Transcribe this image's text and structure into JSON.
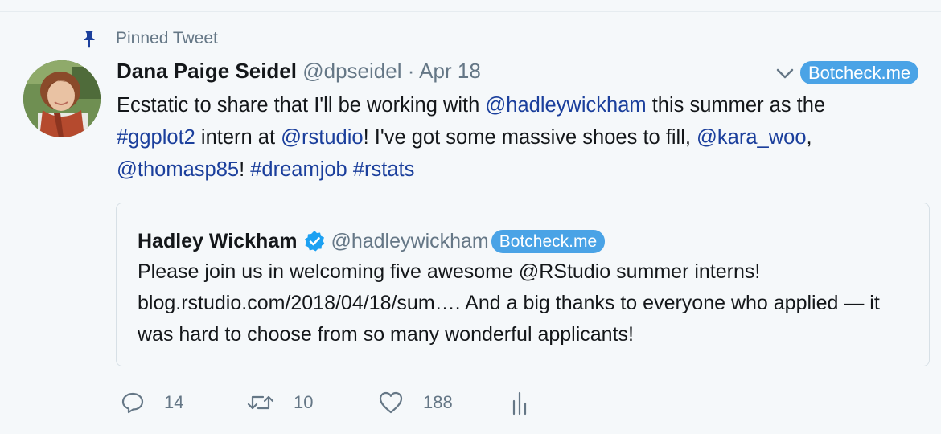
{
  "pinned": {
    "label": "Pinned Tweet",
    "icon": "pin-icon"
  },
  "author": {
    "name": "Dana Paige Seidel",
    "handle": "@dpseidel",
    "separator": "·",
    "date": "Apr 18",
    "botcheck": "Botcheck.me"
  },
  "tweet": {
    "l1_a": "Ecstatic to share that I'll be working with ",
    "l1_m1": "@hadleywickham",
    "l1_b": " this summer as the",
    "l2_h1": "#ggplot2",
    "l2_a": " intern at ",
    "l2_m2": "@rstudio",
    "l2_b": "!  I've got some massive shoes to fill, ",
    "l2_m3": "@kara_woo",
    "l2_c": ",",
    "l3_m4": "@thomasp85",
    "l3_a": "!  ",
    "l3_h2": "#dreamjob",
    "l3_b": " ",
    "l3_h3": "#rstats"
  },
  "quote": {
    "name": "Hadley Wickham",
    "handle": "@hadleywickham",
    "botcheck": "Botcheck.me",
    "text": "Please join us in welcoming five awesome @RStudio summer interns! blog.rstudio.com/2018/04/18/sum…. And a big thanks to everyone who applied — it was hard to choose from so many wonderful applicants!"
  },
  "actions": {
    "replies": "14",
    "retweets": "10",
    "likes": "188"
  },
  "colors": {
    "link": "#1b3f9c",
    "muted": "#657786",
    "botcheck": "#4aa3e6",
    "verified": "#1da1f2",
    "pin": "#1b3f9c"
  }
}
